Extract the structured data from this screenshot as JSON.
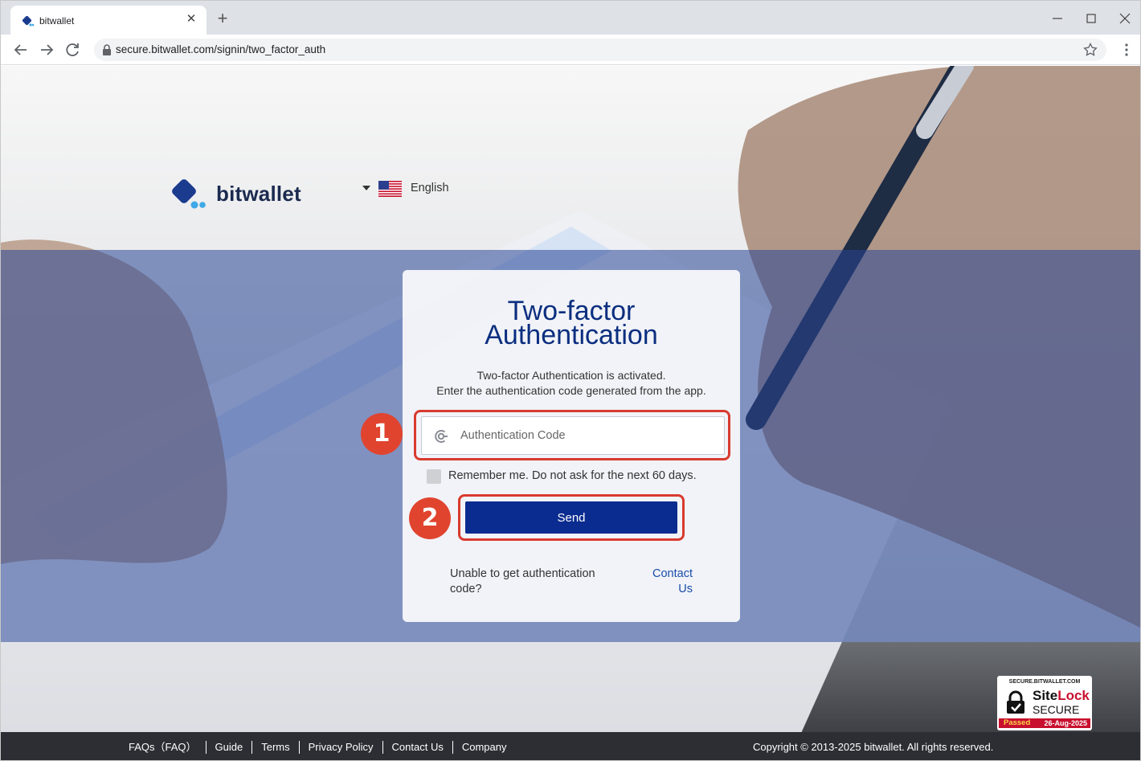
{
  "browser": {
    "tab_title": "bitwallet",
    "tab_close": "✕",
    "new_tab": "+",
    "url": "secure.bitwallet.com/signin/two_factor_auth"
  },
  "header": {
    "logo_text": "bitwallet",
    "language": "English"
  },
  "card": {
    "title_line1": "Two-factor",
    "title_line2": "Authentication",
    "desc_line1": "Two-factor Authentication is activated.",
    "desc_line2": "Enter the authentication code generated from the app.",
    "code_placeholder": "Authentication Code",
    "remember_label": "Remember me. Do not ask for the next 60 days.",
    "send_label": "Send",
    "help_text": "Unable to get authentication code?",
    "contact_link": "Contact Us"
  },
  "markers": [
    "1",
    "2"
  ],
  "sitelock": {
    "domain": "SECURE.BITWALLET.COM",
    "name_a": "Site",
    "name_b": "Lock",
    "secure": "SECURE",
    "passed": "Passed",
    "date": "26-Aug-2025"
  },
  "footer": {
    "links": [
      "FAQs（FAQ）",
      "Guide",
      "Terms",
      "Privacy Policy",
      "Contact Us",
      "Company"
    ],
    "copyright": "Copyright © 2013-2025 bitwallet. All rights reserved."
  },
  "colors": {
    "brand_navy": "#0b2e7f",
    "button": "#0a2b8f",
    "highlight": "#d93a2f",
    "link": "#1a4ca8"
  }
}
